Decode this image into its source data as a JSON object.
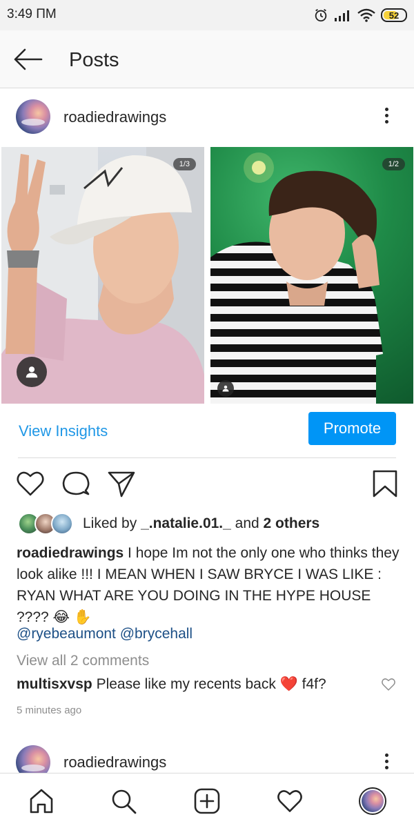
{
  "status_bar": {
    "time": "3:49 ПМ",
    "battery": "52"
  },
  "app_bar": {
    "title": "Posts"
  },
  "post": {
    "username": "roadiedrawings",
    "images": [
      {
        "counter": "1/3"
      },
      {
        "counter": "1/2"
      }
    ],
    "view_insights": "View Insights",
    "promote": "Promote",
    "liked_by_prefix": "Liked by",
    "liked_by_user": "_.natalie.01._",
    "liked_by_and": "and",
    "liked_by_others": "2 others",
    "caption_user": "roadiedrawings",
    "caption_text": "I hope Im not the only one who thinks they look alike !!! I MEAN WHEN I SAW BRYCE I WAS LIKE : RYAN WHAT ARE YOU DOING IN THE HYPE HOUSE ???? 😂 ✋",
    "mentions": "@ryebeaumont @brycehall",
    "view_comments": "View all 2 comments",
    "comment_user": "multisxvsp",
    "comment_text": "Please like my recents back ❤️ f4f?",
    "timestamp": "5 minutes ago"
  },
  "next_post": {
    "username": "roadiedrawings"
  },
  "icons": {
    "back": "arrow-left-icon",
    "more": "more-vertical-icon",
    "like": "heart-icon",
    "comment": "comment-icon",
    "share": "send-icon",
    "save": "bookmark-icon",
    "nav": [
      "home-icon",
      "search-icon",
      "add-post-icon",
      "activity-heart-icon",
      "profile-avatar"
    ]
  },
  "colors": {
    "link": "#1f97e6",
    "promote_bg": "#0095f6",
    "mention": "#1c4f86",
    "muted": "#8e8e8e",
    "text": "#262626"
  }
}
